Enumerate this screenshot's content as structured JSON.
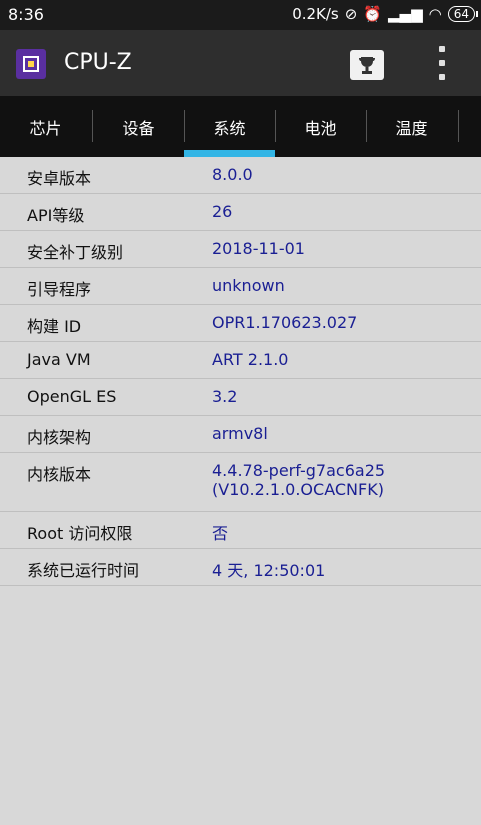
{
  "statusbar": {
    "time": "8:36",
    "net_speed": "0.2K/s",
    "battery": "64"
  },
  "appbar": {
    "title": "CPU-Z",
    "logo_icon": "cpu-chip-icon",
    "trophy_icon": "trophy-icon",
    "menu_icon": "overflow-menu-icon"
  },
  "tabs": [
    {
      "label": "芯片"
    },
    {
      "label": "设备"
    },
    {
      "label": "系统",
      "active": true
    },
    {
      "label": "电池"
    },
    {
      "label": "温度"
    }
  ],
  "system": {
    "rows": [
      {
        "label": "安卓版本",
        "value": "8.0.0"
      },
      {
        "label": "API等级",
        "value": "26"
      },
      {
        "label": "安全补丁级别",
        "value": "2018-11-01"
      },
      {
        "label": "引导程序",
        "value": "unknown"
      },
      {
        "label": "构建 ID",
        "value": "OPR1.170623.027"
      },
      {
        "label": "Java VM",
        "value": "ART 2.1.0"
      },
      {
        "label": "OpenGL ES",
        "value": "3.2"
      },
      {
        "label": "内核架构",
        "value": "armv8l"
      },
      {
        "label": "内核版本",
        "value": "4.4.78-perf-g7ac6a25\n(V10.2.1.0.OCACNFK)"
      },
      {
        "label": "Root 访问权限",
        "value": "否"
      },
      {
        "label": "系统已运行时间",
        "value": "4 天, 12:50:01"
      }
    ]
  },
  "colors": {
    "accent": "#33b5e5",
    "value_text": "#1a1f93",
    "background": "#d8d8d8"
  }
}
